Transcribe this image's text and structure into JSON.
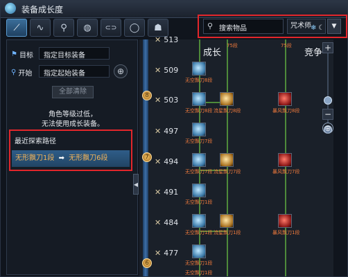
{
  "window": {
    "title": "装备成长度"
  },
  "tabs": [
    {
      "icon": "sword-icon",
      "glyph": "⟋"
    },
    {
      "icon": "whip-icon",
      "glyph": "∿"
    },
    {
      "icon": "staff-icon",
      "glyph": "⚲"
    },
    {
      "icon": "ring-icon",
      "glyph": "◍"
    },
    {
      "icon": "bracelet-icon",
      "glyph": "⊂⊃"
    },
    {
      "icon": "belt-icon",
      "glyph": "◯"
    },
    {
      "icon": "pet-icon",
      "glyph": "☗"
    }
  ],
  "left": {
    "target_label": "目标",
    "target_value": "指定目标装备",
    "start_label": "开始",
    "start_value": "指定起始装备",
    "clear_button": "全部清除",
    "message_line1": "角色等级过低，",
    "message_line2": "无法使用成长装备。",
    "recent_header": "最近探索路径",
    "recent_from": "无形飘刀1段",
    "recent_arrow": "➡",
    "recent_to": "无形飘刀6段"
  },
  "top": {
    "search_placeholder": "搜索物品",
    "class_name": "咒术师",
    "dropdown_glyph": "▼"
  },
  "tree": {
    "col_growth": "成长",
    "col_compete": "竞争",
    "levels": [
      "513",
      "509",
      "503",
      "497",
      "494",
      "491",
      "484",
      "477"
    ],
    "medals": [
      "8",
      "7",
      "6"
    ],
    "labels": {
      "r0": [
        "75段",
        "75段"
      ],
      "r1": "无空飘刀8段",
      "r2": [
        "无空飘刀8段",
        "流星飘刀8段",
        "暴风飘刀8段"
      ],
      "r3": "无空飘刀7段",
      "r4": [
        "无空飘刀7段",
        "流星飘刀7段",
        "暴风飘刀7段"
      ],
      "r5": "无空飘刀1段",
      "r6": [
        "无空飘刀1段",
        "流星飘刀1段",
        "暴风飘刀1段"
      ],
      "r7": [
        "无空飘刀1段",
        "无空飘刀1段"
      ]
    }
  },
  "colors": {
    "highlight": "#e3262b",
    "timeline": "#3d6fa8",
    "label": "#f07a3c"
  }
}
